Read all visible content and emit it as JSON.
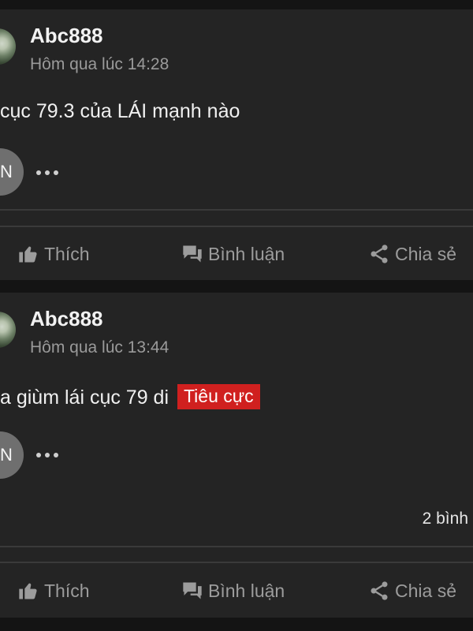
{
  "posts": [
    {
      "author": "Abc888",
      "time": "Hôm qua lúc 14:28",
      "content": "cục 79.3 của LÁI mạnh nào",
      "reactor_initial": "N",
      "actions": {
        "like": "Thích",
        "comment": "Bình luận",
        "share": "Chia sẻ"
      }
    },
    {
      "author": "Abc888",
      "time": "Hôm qua lúc 13:44",
      "content": "a giùm lái cục 79 di",
      "tag": "Tiêu cực",
      "reactor_initial": "N",
      "comment_count": "2 bình",
      "actions": {
        "like": "Thích",
        "comment": "Bình luận",
        "share": "Chia sẻ"
      }
    }
  ],
  "colors": {
    "background": "#141414",
    "card": "#242424",
    "negative_tag": "#d0201f",
    "muted": "#9c9c9c"
  },
  "icons": {
    "like": "thumbs-up-icon",
    "comment": "comment-bubbles-icon",
    "share": "share-icon",
    "more": "more-dots-icon"
  }
}
